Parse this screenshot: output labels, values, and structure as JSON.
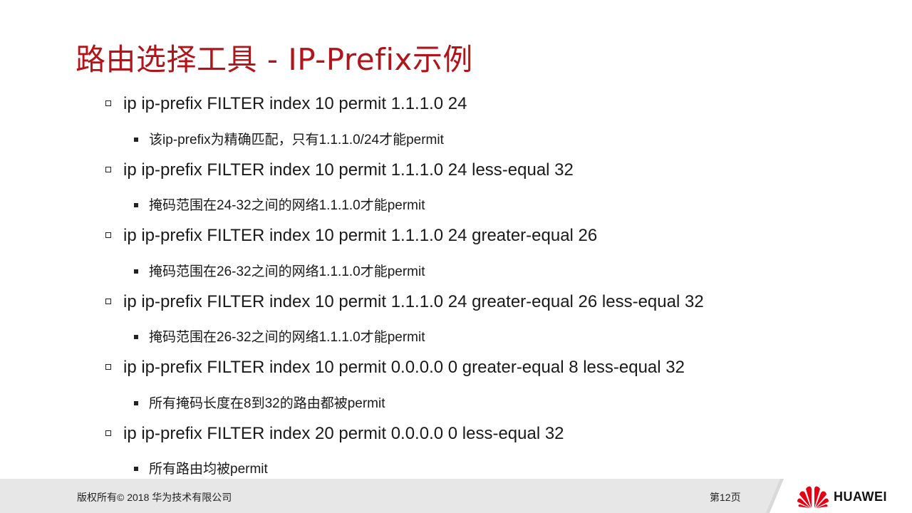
{
  "slide": {
    "title": "路由选择工具 - IP-Prefix示例",
    "items": [
      {
        "text": "ip ip-prefix FILTER index 10 permit 1.1.1.0 24",
        "sub": "该ip-prefix为精确匹配，只有1.1.1.0/24才能permit"
      },
      {
        "text": "ip ip-prefix FILTER index 10 permit 1.1.1.0 24 less-equal 32",
        "sub": "掩码范围在24-32之间的网络1.1.1.0才能permit"
      },
      {
        "text": "ip ip-prefix FILTER index 10 permit 1.1.1.0 24 greater-equal 26",
        "sub": "掩码范围在26-32之间的网络1.1.1.0才能permit"
      },
      {
        "text": "ip ip-prefix FILTER index 10 permit 1.1.1.0 24 greater-equal 26 less-equal 32",
        "sub": "掩码范围在26-32之间的网络1.1.1.0才能permit"
      },
      {
        "text": "ip ip-prefix FILTER index 10 permit 0.0.0.0 0 greater-equal 8 less-equal 32",
        "sub": "所有掩码长度在8到32的路由都被permit"
      },
      {
        "text": "ip ip-prefix FILTER index 20 permit 0.0.0.0 0 less-equal 32",
        "sub": "所有路由均被permit"
      }
    ]
  },
  "footer": {
    "copyright": "版权所有© 2018 华为技术有限公司",
    "page": "第12页",
    "brand": "HUAWEI"
  },
  "colors": {
    "title": "#b1141b",
    "footer_bg": "#e7e7e7",
    "logo_red": "#e60012"
  },
  "icons": {
    "bullet_level1": "hollow-square-bullet-icon",
    "bullet_level2": "filled-square-bullet-icon",
    "logo": "huawei-petal-logo-icon"
  }
}
